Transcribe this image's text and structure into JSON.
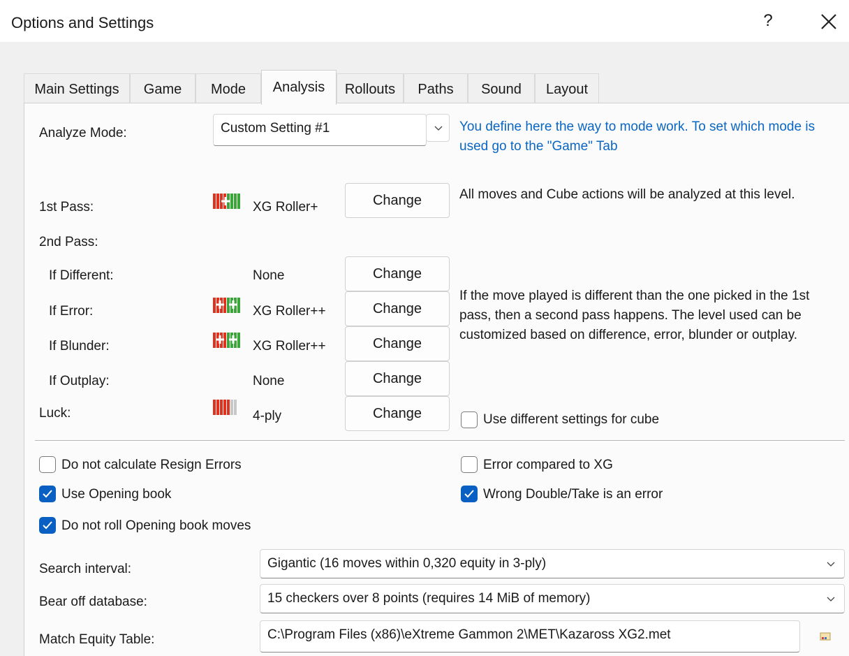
{
  "window": {
    "title": "Options and Settings",
    "help_label": "?",
    "close_icon": "close-icon"
  },
  "tabs": [
    {
      "label": "Main Settings"
    },
    {
      "label": "Game"
    },
    {
      "label": "Mode"
    },
    {
      "label": "Analysis",
      "active": true
    },
    {
      "label": "Rollouts"
    },
    {
      "label": "Paths"
    },
    {
      "label": "Sound"
    },
    {
      "label": "Layout"
    }
  ],
  "analyze": {
    "label": "Analyze Mode:",
    "value": "Custom Setting #1",
    "hint": "You define here the way to mode work. To set which mode is used go to the \"Game\" Tab"
  },
  "passes": {
    "first_label": "1st Pass:",
    "first_level": "XG Roller+",
    "first_note": "All moves and Cube actions will be analyzed at this level.",
    "second_label": "2nd Pass:",
    "if_different_label": "If Different:",
    "if_different_level": "None",
    "if_error_label": "If Error:",
    "if_error_level": "XG Roller++",
    "if_blunder_label": "If Blunder:",
    "if_blunder_level": "XG Roller++",
    "if_outplay_label": "If Outplay:",
    "if_outplay_level": "None",
    "second_note": "If the move played is different than the one picked in the 1st pass, then a second pass happens. The level used can be customized based on difference, error, blunder or outplay.",
    "luck_label": "Luck:",
    "luck_level": "4-ply",
    "change_label": "Change"
  },
  "options": {
    "use_diff_cube": {
      "label": "Use different settings for cube",
      "checked": false
    },
    "no_resign_errors": {
      "label": "Do not calculate Resign Errors",
      "checked": false
    },
    "error_vs_xg": {
      "label": "Error compared to XG",
      "checked": false
    },
    "use_opening_book": {
      "label": "Use Opening book",
      "checked": true
    },
    "wrong_double": {
      "label": "Wrong Double/Take is an error",
      "checked": true
    },
    "no_roll_book": {
      "label": "Do not roll Opening book moves",
      "checked": true
    }
  },
  "search": {
    "label": "Search interval:",
    "value": "Gigantic (16 moves within 0,320 equity in 3-ply)"
  },
  "bearoff": {
    "label": "Bear off database:",
    "value": "15 checkers over 8 points (requires 14 MiB of memory)"
  },
  "met": {
    "label": "Match Equity Table:",
    "value": "C:\\Program Files (x86)\\eXtreme Gammon 2\\MET\\Kazaross XG2.met",
    "browse_icon": "folder-browse-icon"
  },
  "colors": {
    "accent": "#0a5fc2",
    "link_text": "#0a66c2"
  }
}
